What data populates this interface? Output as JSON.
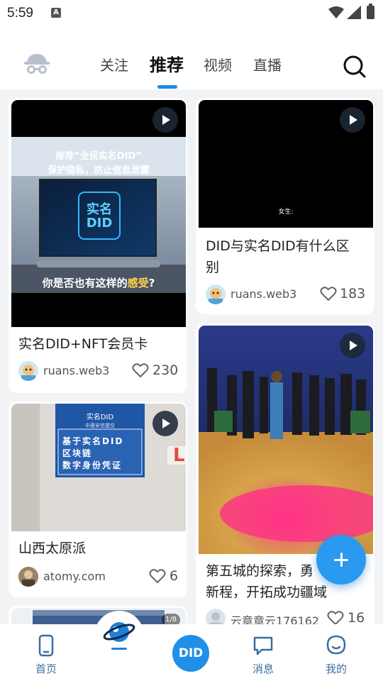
{
  "status_bar": {
    "time": "5:59",
    "notif_letter": "A"
  },
  "header": {
    "tabs": [
      {
        "label": "关注",
        "active": false
      },
      {
        "label": "推荐",
        "active": true
      },
      {
        "label": "视频",
        "active": false
      },
      {
        "label": "直播",
        "active": false
      }
    ]
  },
  "feed": {
    "cards": [
      {
        "title": "实名DID+NFT会员卡",
        "user": "ruans.web3",
        "likes": "230",
        "has_play": true,
        "overlay": {
          "headline1": "推荐“全民实名DID”",
          "headline2": "保护隐私，防止信息泄露",
          "screen_line1": "实名",
          "screen_line2": "DID",
          "caption_prefix": "你是否也有这样的",
          "caption_highlight": "感受",
          "caption_suffix": "?"
        }
      },
      {
        "title": "DID与实名DID有什么区别",
        "title_line1": "DID与实名DID有什么区",
        "title_line2": "别",
        "user": "ruans.web3",
        "likes": "183",
        "has_play": true,
        "overlay": {
          "subtitle": "女生:"
        }
      },
      {
        "title": "山西太原派",
        "user": "atomy.com",
        "likes": "6",
        "has_play": true,
        "overlay": {
          "sign_top": "实名DID",
          "sign_sub": "中唐安信提交",
          "sign_line1": "基于实名DID",
          "sign_line2": "区块链",
          "sign_line3": "数字身份凭证",
          "side_char": "L"
        }
      },
      {
        "title_line1": "第五城的探索，勇",
        "title_line2": "新程，开拓成功疆域",
        "user": "云章章云176162",
        "likes": "16",
        "has_play": true
      },
      {
        "badge": "1/8"
      }
    ]
  },
  "bottom_nav": {
    "items": [
      {
        "label": "首页"
      },
      {
        "label": ""
      },
      {
        "label": "DID"
      },
      {
        "label": "消息"
      },
      {
        "label": "我的"
      }
    ]
  },
  "colors": {
    "accent": "#1e8ae6",
    "nav_label": "#3a6ea0"
  }
}
